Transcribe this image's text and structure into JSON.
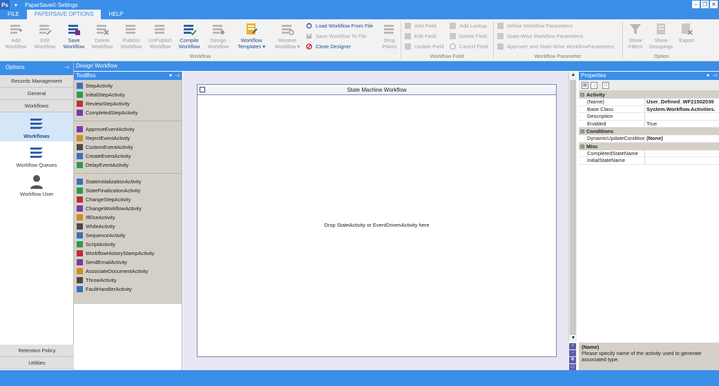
{
  "window": {
    "title": "PaperSave© Settings",
    "app_icon": "Ps"
  },
  "menu_tabs": [
    "FILE",
    "PAPERSAVE OPTIONS",
    "HELP"
  ],
  "ribbon": {
    "big_buttons": [
      {
        "line1": "Add",
        "line2": "Workflow",
        "icon": "add-workflow-icon",
        "enabled": false
      },
      {
        "line1": "Edit",
        "line2": "Workflow",
        "icon": "edit-workflow-icon",
        "enabled": false
      },
      {
        "line1": "Save",
        "line2": "Workflow",
        "icon": "save-workflow-icon",
        "enabled": true
      },
      {
        "line1": "Delete",
        "line2": "Workflow",
        "icon": "delete-workflow-icon",
        "enabled": false
      },
      {
        "line1": "Publish",
        "line2": "Workflow",
        "icon": "publish-workflow-icon",
        "enabled": false
      },
      {
        "line1": "UnPublish",
        "line2": "Workflow",
        "icon": "unpublish-workflow-icon",
        "enabled": false
      },
      {
        "line1": "Compile",
        "line2": "Workflow",
        "icon": "compile-workflow-icon",
        "enabled": true
      },
      {
        "line1": "Design",
        "line2": "Workflow",
        "icon": "design-workflow-icon",
        "enabled": false
      },
      {
        "line1": "Workflow",
        "line2": "Templates ▾",
        "icon": "workflow-templates-icon",
        "enabled": true
      },
      {
        "line1": "Restore",
        "line2": "Workflow ▾",
        "icon": "restore-workflow-icon",
        "enabled": false
      }
    ],
    "file_actions": [
      {
        "label": "Load Workflow From File",
        "icon": "load-icon",
        "enabled": true
      },
      {
        "label": "Save Workflow To File",
        "icon": "save-to-file-icon",
        "enabled": false
      },
      {
        "label": "Close Designer",
        "icon": "close-designer-icon",
        "enabled": true
      }
    ],
    "drop_points": {
      "line1": "Drop",
      "line2": "Points"
    },
    "field_actions": [
      {
        "label": "Add Field",
        "icon": "add-field-icon"
      },
      {
        "label": "Edit Field",
        "icon": "edit-field-icon"
      },
      {
        "label": "Update Field",
        "icon": "update-field-icon"
      },
      {
        "label": "Add Lookup",
        "icon": "add-lookup-icon"
      },
      {
        "label": "Delete Field",
        "icon": "delete-field-icon"
      },
      {
        "label": "Cancel Field",
        "icon": "cancel-field-icon"
      }
    ],
    "parameter_actions": [
      {
        "label": "Define Workflow Parameters",
        "icon": "define-params-icon"
      },
      {
        "label": "State-Wise Workflow Parameters",
        "icon": "state-params-icon"
      },
      {
        "label": "Approver and State-Wise WorkflowParameters",
        "icon": "approver-params-icon"
      }
    ],
    "option_buttons": [
      {
        "line1": "Show",
        "line2": "Filters",
        "icon": "filter-icon"
      },
      {
        "line1": "Show",
        "line2": "Groupings",
        "icon": "groupings-icon"
      },
      {
        "line1": "Export",
        "line2": "",
        "icon": "export-icon"
      }
    ],
    "groups": {
      "workflow": "Workflow",
      "workflow_field": "Workflow Field",
      "workflow_parameter": "Workflow Parameter",
      "option": "Option"
    }
  },
  "options_pane": {
    "title": "Options",
    "nav_buttons": [
      "Records Management",
      "General",
      "Workflows"
    ],
    "items": [
      {
        "label": "Workflows",
        "selected": true
      },
      {
        "label": "Workflow Queues",
        "selected": false
      },
      {
        "label": "Workflow User",
        "selected": false
      }
    ],
    "bottom_buttons": [
      "Retention Policy",
      "Utilities"
    ]
  },
  "design_header": "Design Workflow",
  "toolbox": {
    "title": "ToolBox",
    "groups": [
      [
        "StepActivity",
        "InitialStepActivity",
        "ReviewStepActivity",
        "CompletedStepActivity"
      ],
      [
        "ApproveEventActivity",
        "RejectEventActivity",
        "CustomEventActivity",
        "CreateEventActivity",
        "DelayEventActivity"
      ],
      [
        "StateInitializationActivity",
        "StateFinalizationActivity",
        "ChangeStepActivity",
        "ChangeWorkflowActivity",
        "IfElseActivity",
        "WhileActivity",
        "SequenceActivity",
        "ScriptActivity",
        "WorkflowHistoryStampActivity",
        "SendEmailActivity",
        "AssociateDocumentActivity",
        "ThrowActivity",
        "FaultHandlerActivity"
      ]
    ]
  },
  "designer": {
    "workflow_title": "State Machine Workflow",
    "drop_hint": "Drop StateActivity or EventDrivenActivity here"
  },
  "properties": {
    "title": "Properties",
    "categories": [
      {
        "name": "Activity",
        "rows": [
          {
            "name": "(Name)",
            "value": "User_Defined_WF21502030",
            "bold": true
          },
          {
            "name": "Base Class",
            "value": "System.Workflow.Activities.",
            "bold": true
          },
          {
            "name": "Description",
            "value": "",
            "bold": false
          },
          {
            "name": "Enabled",
            "value": "True",
            "bold": false
          }
        ]
      },
      {
        "name": "Conditions",
        "rows": [
          {
            "name": "DynamicUpdateCondition",
            "value": "(None)",
            "bold": true
          }
        ]
      },
      {
        "name": "Misc",
        "rows": [
          {
            "name": "CompletedStateName",
            "value": "",
            "bold": false
          },
          {
            "name": "InitialStateName",
            "value": "",
            "bold": false
          }
        ]
      }
    ],
    "description_title": "(Name)",
    "description_text": "Please specify name of the activity used to generate associated type."
  }
}
